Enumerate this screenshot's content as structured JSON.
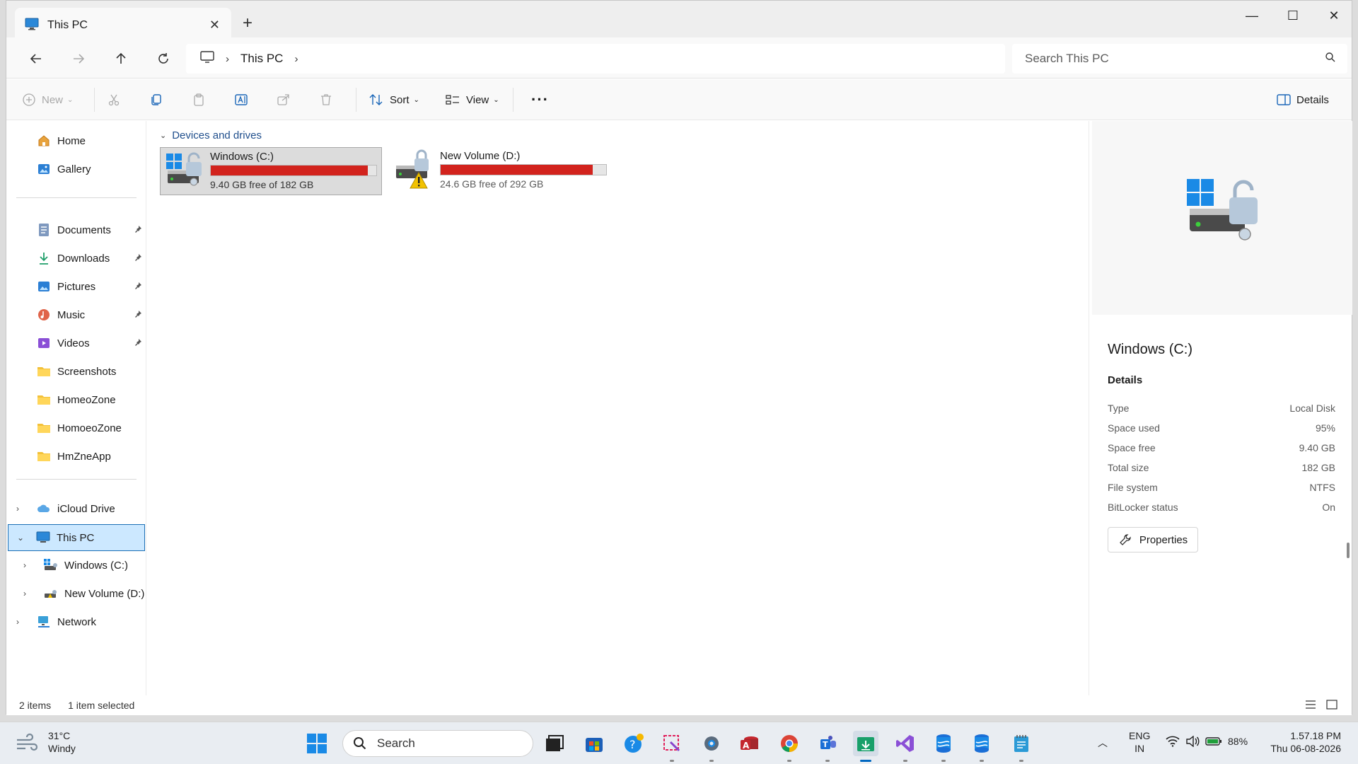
{
  "window": {
    "tab_title": "This PC"
  },
  "address": {
    "location": "This PC",
    "search_placeholder": "Search This PC"
  },
  "toolbar": {
    "new_label": "New",
    "sort_label": "Sort",
    "view_label": "View",
    "details_label": "Details"
  },
  "sidebar": {
    "home": "Home",
    "gallery": "Gallery",
    "quick": [
      {
        "label": "Documents",
        "icon": "documents-icon",
        "pinned": true
      },
      {
        "label": "Downloads",
        "icon": "downloads-icon",
        "pinned": true
      },
      {
        "label": "Pictures",
        "icon": "pictures-icon",
        "pinned": true
      },
      {
        "label": "Music",
        "icon": "music-icon",
        "pinned": true
      },
      {
        "label": "Videos",
        "icon": "videos-icon",
        "pinned": true
      },
      {
        "label": "Screenshots",
        "icon": "folder-icon",
        "pinned": false
      },
      {
        "label": "HomeoZone",
        "icon": "folder-icon",
        "pinned": false
      },
      {
        "label": "HomoeoZone",
        "icon": "folder-icon",
        "pinned": false
      },
      {
        "label": "HmZneApp",
        "icon": "folder-icon",
        "pinned": false
      }
    ],
    "icloud": "iCloud Drive",
    "thispc": "This PC",
    "drive_c": "Windows (C:)",
    "drive_d": "New Volume (D:)",
    "network": "Network"
  },
  "content": {
    "group_title": "Devices and drives",
    "drives": [
      {
        "name": "Windows (C:)",
        "free": "9.40 GB free of 182 GB",
        "used_fraction": 0.95
      },
      {
        "name": "New Volume (D:)",
        "free": "24.6 GB free of 292 GB",
        "used_fraction": 0.92
      }
    ]
  },
  "details": {
    "title": "Windows (C:)",
    "section": "Details",
    "rows": [
      {
        "label": "Type",
        "value": "Local Disk"
      },
      {
        "label": "Space used",
        "value": "95%"
      },
      {
        "label": "Space free",
        "value": "9.40 GB"
      },
      {
        "label": "Total size",
        "value": "182 GB"
      },
      {
        "label": "File system",
        "value": "NTFS"
      },
      {
        "label": "BitLocker status",
        "value": "On"
      }
    ],
    "properties_label": "Properties"
  },
  "status": {
    "items": "2 items",
    "selected": "1 item selected"
  },
  "taskbar": {
    "temp": "31°C",
    "condition": "Windy",
    "search_label": "Search",
    "lang": "ENG",
    "region": "IN",
    "battery": "88%",
    "time": "1.57.18 PM",
    "date": "Thu 06-08-2026"
  },
  "colors": {
    "drive_bar_full": "#d2231d",
    "selection": "#cce8ff",
    "accent": "#0067c0"
  }
}
